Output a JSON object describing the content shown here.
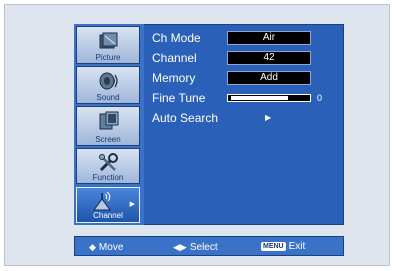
{
  "sidebar": {
    "items": [
      {
        "label": "Picture",
        "icon": "picture-icon",
        "active": false
      },
      {
        "label": "Sound",
        "icon": "sound-icon",
        "active": false
      },
      {
        "label": "Screen",
        "icon": "screen-icon",
        "active": false
      },
      {
        "label": "Function",
        "icon": "function-icon",
        "active": false
      },
      {
        "label": "Channel",
        "icon": "channel-icon",
        "active": true
      }
    ]
  },
  "menu": {
    "ch_mode": {
      "label": "Ch Mode",
      "value": "Air"
    },
    "channel": {
      "label": "Channel",
      "value": "42"
    },
    "memory": {
      "label": "Memory",
      "value": "Add"
    },
    "fine_tune": {
      "label": "Fine Tune",
      "value": "0",
      "level": 0.75
    },
    "auto_search": {
      "label": "Auto Search"
    }
  },
  "footer": {
    "move": "Move",
    "select": "Select",
    "exit_key": "MENU",
    "exit": "Exit"
  },
  "colors": {
    "panel": "#2a60b8",
    "sidebar": "#3a72c8",
    "value_box": "#000000",
    "text": "#ffffff"
  }
}
